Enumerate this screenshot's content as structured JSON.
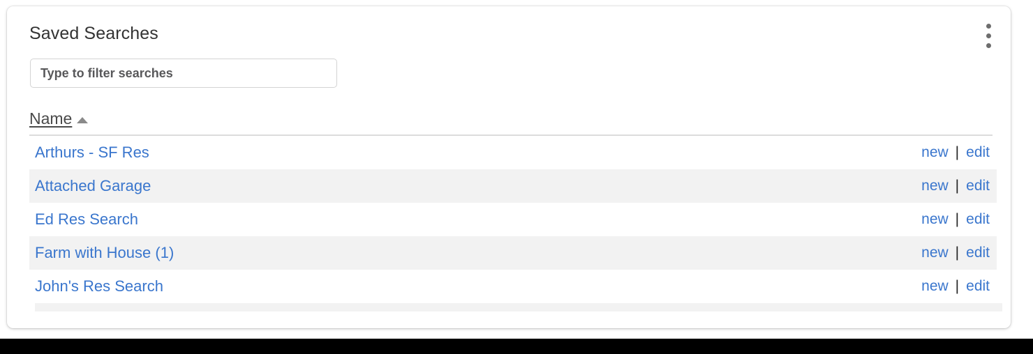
{
  "panel": {
    "title": "Saved Searches",
    "menu_icon": "kebab-menu-icon"
  },
  "filter": {
    "placeholder": "Type to filter searches",
    "value": ""
  },
  "table": {
    "columns": [
      {
        "label": "Name",
        "sort": "ascending",
        "sort_icon": "triangle-up-icon"
      }
    ],
    "action_separator": "|",
    "rows": [
      {
        "name": "Arthurs - SF Res",
        "new_label": "new",
        "edit_label": "edit"
      },
      {
        "name": "Attached Garage",
        "new_label": "new",
        "edit_label": "edit"
      },
      {
        "name": "Ed Res Search",
        "new_label": "new",
        "edit_label": "edit"
      },
      {
        "name": "Farm with House (1)",
        "new_label": "new",
        "edit_label": "edit"
      },
      {
        "name": "John's Res Search",
        "new_label": "new",
        "edit_label": "edit"
      }
    ]
  },
  "colors": {
    "link": "#3a76cd",
    "stripe": "#f2f2f2",
    "title": "#333333",
    "border": "#dcdcdc"
  }
}
